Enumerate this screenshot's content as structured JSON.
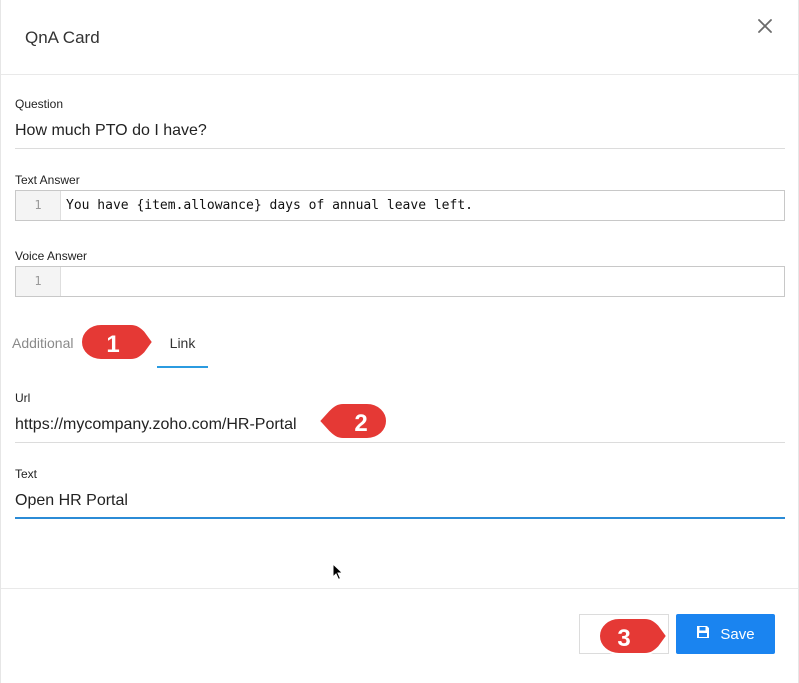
{
  "dialog": {
    "title": "QnA Card",
    "close_icon": "close-icon"
  },
  "question": {
    "label": "Question",
    "value": "How much PTO do I have?"
  },
  "text_answer": {
    "label": "Text Answer",
    "line_number": "1",
    "value": "You have {item.allowance} days of annual leave left."
  },
  "voice_answer": {
    "label": "Voice Answer",
    "line_number": "1",
    "value": ""
  },
  "tabs": {
    "additional": "Additional",
    "link": "Link",
    "active": "Link"
  },
  "url": {
    "label": "Url",
    "value": "https://mycompany.zoho.com/HR-Portal"
  },
  "text": {
    "label": "Text",
    "value": "Open HR Portal"
  },
  "footer": {
    "save_label": "Save",
    "save_icon": "save-icon"
  },
  "callouts": {
    "one": "1",
    "two": "2",
    "three": "3",
    "color": "#e53935"
  },
  "colors": {
    "accent": "#1a84f0",
    "tab_underline": "#2b9be0",
    "focused_underline": "#2b8bd6"
  }
}
